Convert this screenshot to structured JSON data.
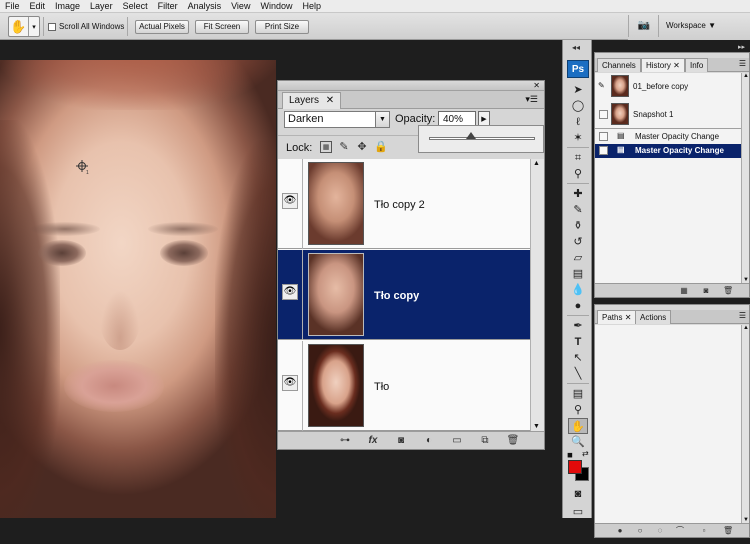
{
  "menu": [
    "File",
    "Edit",
    "Image",
    "Layer",
    "Select",
    "Filter",
    "Analysis",
    "View",
    "Window",
    "Help"
  ],
  "options": {
    "scroll_all_windows": "Scroll All Windows",
    "actual_pixels": "Actual Pixels",
    "fit_screen": "Fit Screen",
    "print_size": "Print Size",
    "workspace": "Workspace ▼"
  },
  "layers_panel": {
    "tab": "Layers",
    "blend_mode": "Darken",
    "opacity_label": "Opacity:",
    "opacity_value": "40%",
    "opacity_fraction": 0.4,
    "lock_label": "Lock:",
    "layers": [
      {
        "name": "Tło copy 2",
        "selected": false
      },
      {
        "name": "Tło copy",
        "selected": true
      },
      {
        "name": "Tło",
        "selected": false
      }
    ]
  },
  "tools": {
    "logo": "Ps"
  },
  "history_panel": {
    "tabs": [
      "Channels",
      "History",
      "Info"
    ],
    "items": [
      {
        "label": "01_before copy",
        "kind": "snapshot",
        "selected": false
      },
      {
        "label": "Snapshot 1",
        "kind": "snapshot",
        "selected": false
      },
      {
        "label": "Master Opacity Change",
        "kind": "state",
        "selected": false
      },
      {
        "label": "Master Opacity Change",
        "kind": "state",
        "selected": true
      }
    ]
  },
  "paths_panel": {
    "tabs": [
      "Paths",
      "Actions"
    ]
  },
  "colors": {
    "foreground": "#e10a0a",
    "background": "#000000",
    "selection": "#0a236b",
    "ps_logo": "#1b6ec2"
  }
}
